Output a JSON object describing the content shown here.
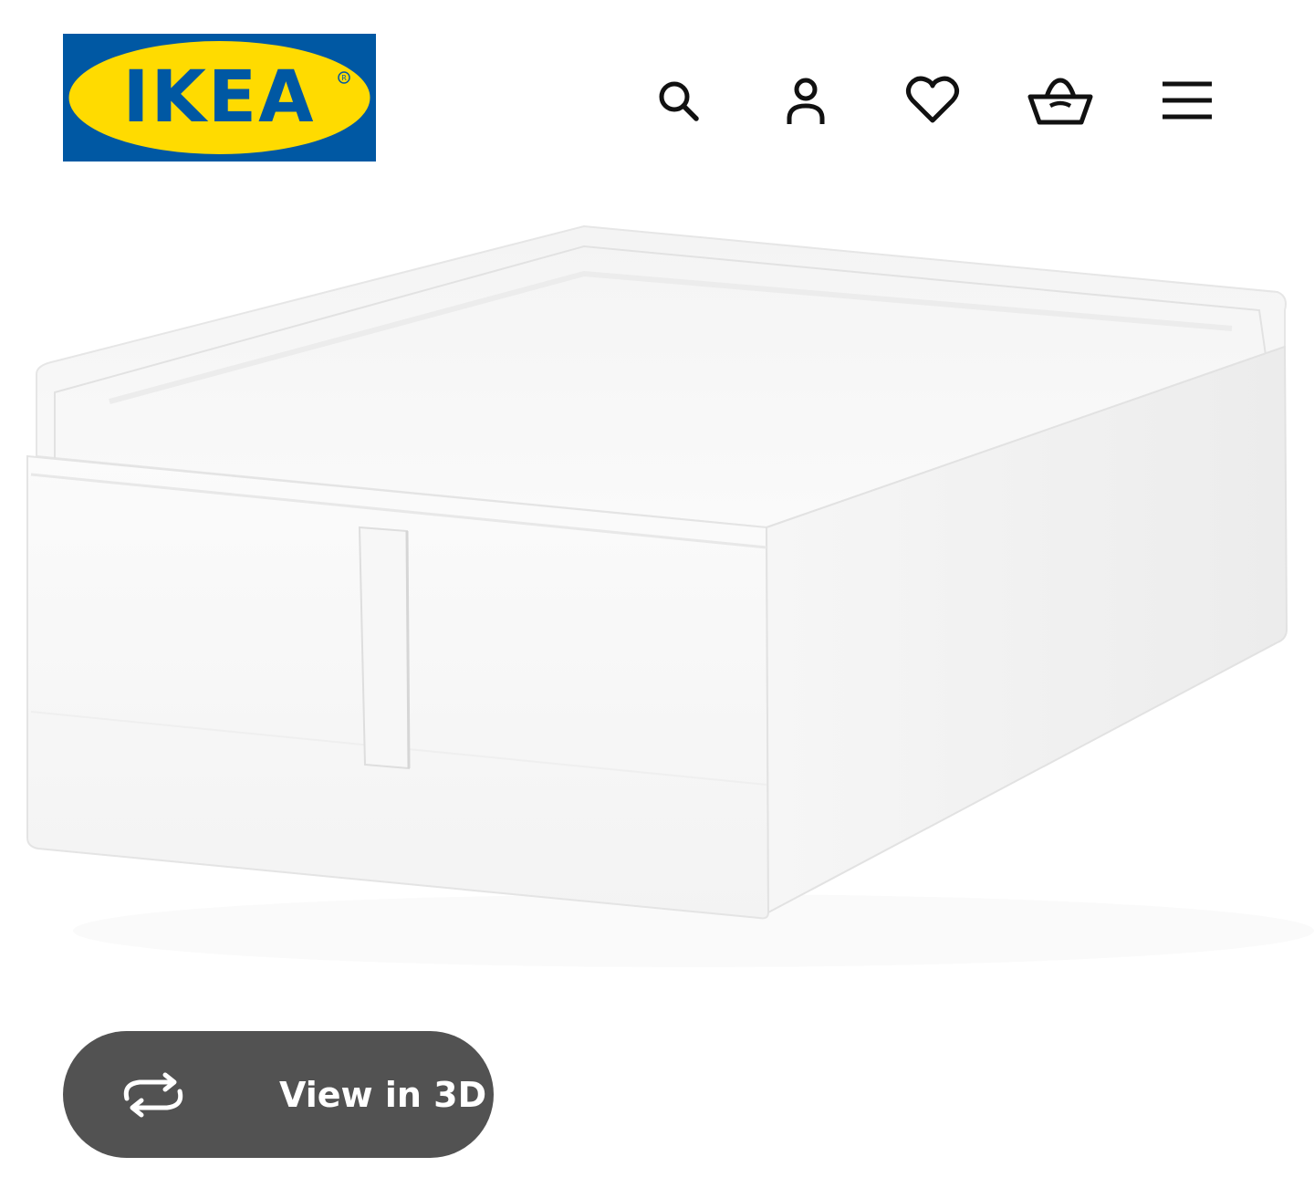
{
  "header": {
    "logo_text": "IKEA",
    "logo_colors": {
      "background": "#0058a3",
      "ellipse": "#ffdb00",
      "text": "#0058a3"
    },
    "icons": [
      {
        "name": "search-icon"
      },
      {
        "name": "account-icon"
      },
      {
        "name": "favourites-icon"
      },
      {
        "name": "shopping-bag-icon"
      },
      {
        "name": "menu-icon"
      }
    ]
  },
  "product": {
    "image": "white-storage-box-with-zip"
  },
  "view3d": {
    "label": "View in 3D",
    "icon": "rotate-arrows-icon",
    "background": "#525252"
  }
}
